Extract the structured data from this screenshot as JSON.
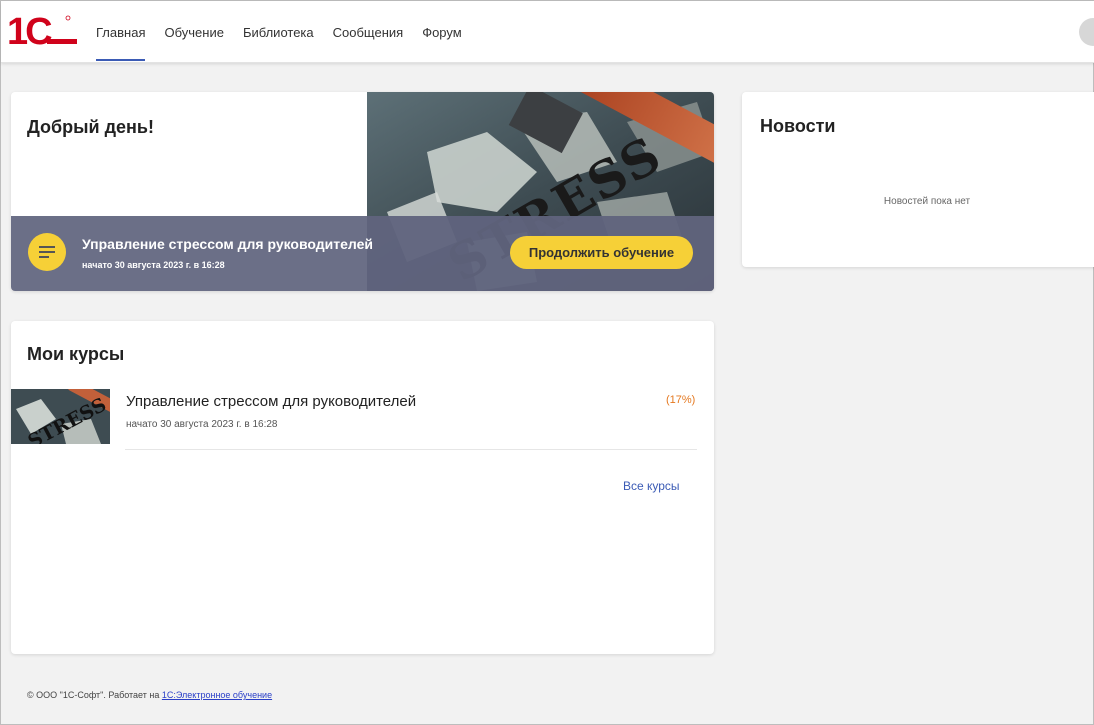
{
  "header": {
    "logo_text": "1C",
    "nav": [
      {
        "label": "Главная",
        "active": true
      },
      {
        "label": "Обучение",
        "active": false
      },
      {
        "label": "Библиотека",
        "active": false
      },
      {
        "label": "Сообщения",
        "active": false
      },
      {
        "label": "Форум",
        "active": false
      }
    ]
  },
  "welcome": {
    "greeting": "Добрый день!",
    "banner_word": "STRESS",
    "current_course": {
      "title": "Управление стрессом для руководителей",
      "started": "начато 30 августа 2023 г. в 16:28",
      "button": "Продолжить обучение"
    }
  },
  "news": {
    "title": "Новости",
    "empty_text": "Новостей пока нет"
  },
  "my_courses": {
    "title": "Мои курсы",
    "items": [
      {
        "name": "Управление стрессом для руководителей",
        "started": "начато 30 августа 2023 г. в 16:28",
        "progress": "(17%)"
      }
    ],
    "all_link": "Все курсы"
  },
  "footer": {
    "text": "© ООО \"1С-Софт\". Работает на ",
    "link": "1С:Электронное обучение"
  },
  "colors": {
    "accent": "#3b5bb5",
    "brand_red": "#d0021b",
    "yellow": "#f6d037",
    "progress": "#e5781f",
    "bar": "#60647e"
  }
}
